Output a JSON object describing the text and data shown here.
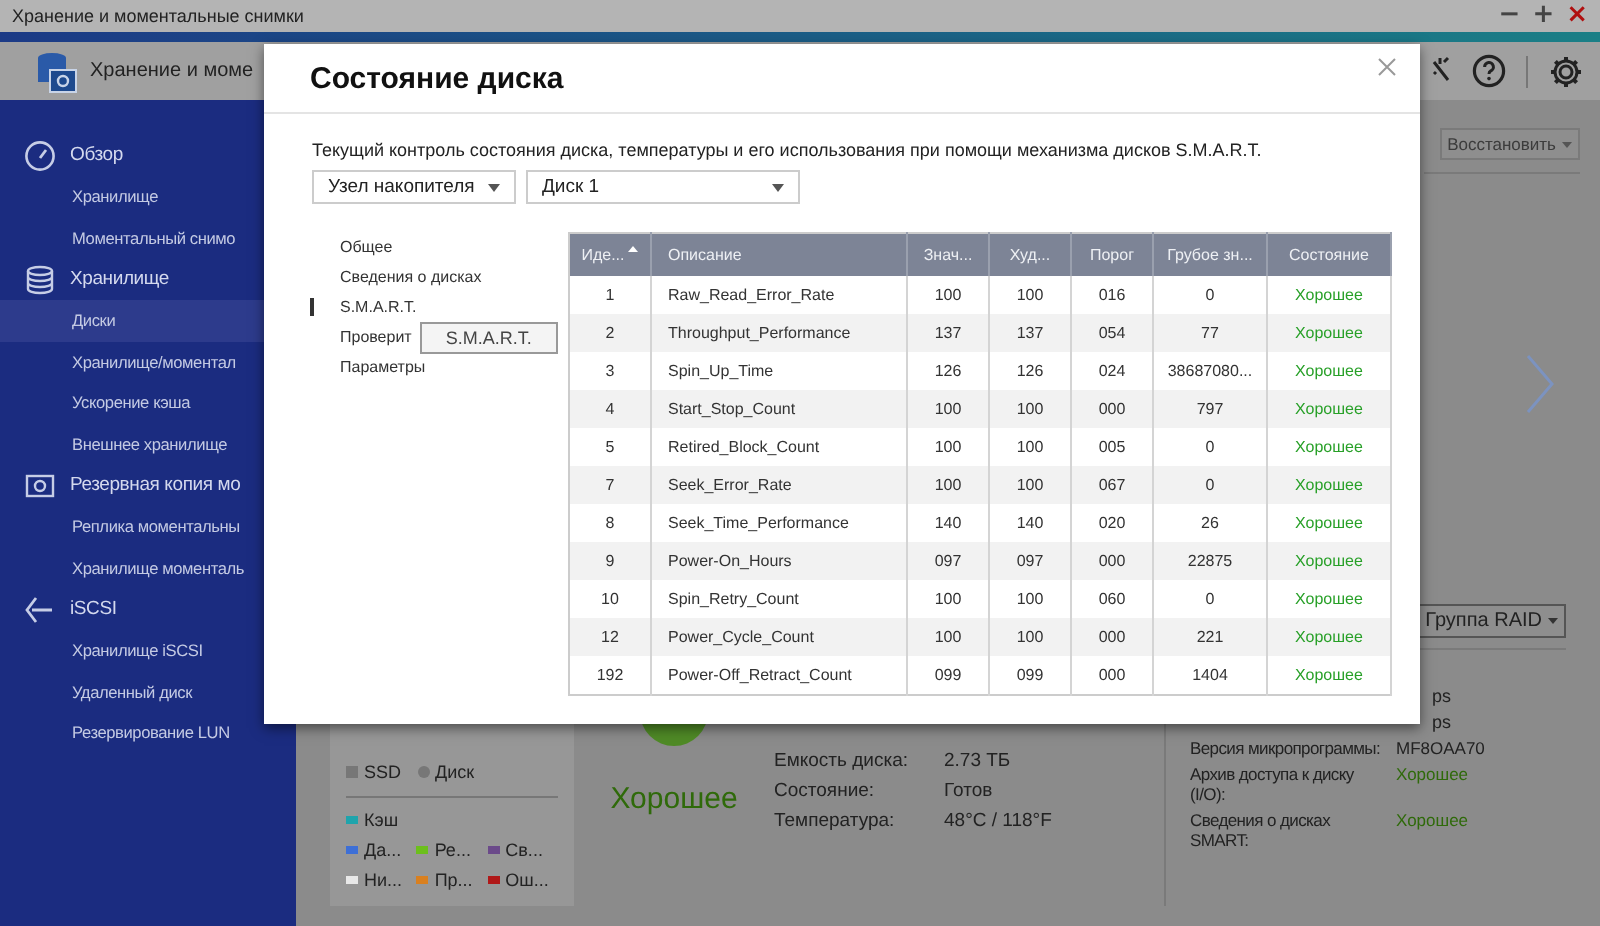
{
  "title_bar": {
    "title": "Хранение и моментальные снимки",
    "controls": [
      "−",
      "+",
      "×"
    ]
  },
  "header": {
    "title": "Хранение и моме"
  },
  "sidebar": {
    "sections": [
      {
        "label": "Обзор",
        "items": [
          {
            "label": "Хранилище",
            "selected": false
          },
          {
            "label": "Моментальный снимо",
            "selected": false
          }
        ]
      },
      {
        "label": "Хранилище",
        "items": [
          {
            "label": "Диски",
            "selected": true
          },
          {
            "label": "Хранилище/моментал",
            "selected": false
          },
          {
            "label": "Ускорение кэша",
            "selected": false
          },
          {
            "label": "Внешнее хранилище",
            "selected": false
          }
        ]
      },
      {
        "label": "Резервная копия мо",
        "items": [
          {
            "label": "Реплика моментальны",
            "selected": false
          },
          {
            "label": "Хранилище моменталь",
            "selected": false
          }
        ]
      },
      {
        "label": "iSCSI",
        "items": [
          {
            "label": "Хранилище iSCSI",
            "selected": false
          },
          {
            "label": "Удаленный диск",
            "selected": false
          },
          {
            "label": "Резервирование LUN",
            "selected": false
          }
        ]
      }
    ]
  },
  "main": {
    "restore_button": "Восстановить",
    "raid_button": "Группа RAID",
    "legend": {
      "types": [
        {
          "label": "SSD",
          "kind": "square"
        },
        {
          "label": "Диск",
          "kind": "circle"
        }
      ],
      "items": [
        {
          "label": "Кэш",
          "color": "#1fa4ac"
        },
        {
          "label": "Да...",
          "color": "#3d6fd6"
        },
        {
          "label": "Ре...",
          "color": "#6cbf1c"
        },
        {
          "label": "Св...",
          "color": "#6b4a8a"
        },
        {
          "label": "Ни...",
          "color": "#e8e8e8"
        },
        {
          "label": "Пр...",
          "color": "#d98020"
        },
        {
          "label": "Ош...",
          "color": "#b01818"
        }
      ]
    },
    "status": "Хорошее",
    "disk_info": [
      {
        "label": "Емкость диска:",
        "value": "2.73 ТБ"
      },
      {
        "label": "Состояние:",
        "value": "Готов"
      },
      {
        "label": "Температура:",
        "value": "48°C / 118°F"
      }
    ],
    "details": [
      {
        "kind": "partial",
        "value": "ps"
      },
      {
        "kind": "partial",
        "value": "ps"
      },
      {
        "kind": "field",
        "label": "Версия микропрограммы:",
        "value": "MF8OAA70",
        "good": false
      },
      {
        "kind": "field",
        "label": "Архив доступа к диску (I/O):",
        "value": "Хорошее",
        "good": true
      },
      {
        "kind": "field",
        "label": "Сведения о дисках SMART:",
        "value": "Хорошее",
        "good": true
      }
    ]
  },
  "modal": {
    "title": "Состояние диска",
    "description": "Текущий контроль состояния диска, температуры и его использования при помощи механизма дисков S.M.A.R.T.",
    "node_select": "Узел накопителя",
    "disk_select": "Диск 1",
    "nav": [
      {
        "label": "Общее",
        "selected": false
      },
      {
        "label": "Сведения о дисках",
        "selected": false
      },
      {
        "label": "S.M.A.R.T.",
        "selected": true
      },
      {
        "label": "Проверит",
        "selected": false
      },
      {
        "label": "Параметры",
        "selected": false
      }
    ],
    "smart_button": "S.M.A.R.T.",
    "table": {
      "columns": [
        "Иде...",
        "Описание",
        "Знач...",
        "Худ...",
        "Порог",
        "Грубое зн...",
        "Состояние"
      ],
      "rows": [
        [
          "1",
          "Raw_Read_Error_Rate",
          "100",
          "100",
          "016",
          "0",
          "Хорошее"
        ],
        [
          "2",
          "Throughput_Performance",
          "137",
          "137",
          "054",
          "77",
          "Хорошее"
        ],
        [
          "3",
          "Spin_Up_Time",
          "126",
          "126",
          "024",
          "38687080...",
          "Хорошее"
        ],
        [
          "4",
          "Start_Stop_Count",
          "100",
          "100",
          "000",
          "797",
          "Хорошее"
        ],
        [
          "5",
          "Retired_Block_Count",
          "100",
          "100",
          "005",
          "0",
          "Хорошее"
        ],
        [
          "7",
          "Seek_Error_Rate",
          "100",
          "100",
          "067",
          "0",
          "Хорошее"
        ],
        [
          "8",
          "Seek_Time_Performance",
          "140",
          "140",
          "020",
          "26",
          "Хорошее"
        ],
        [
          "9",
          "Power-On_Hours",
          "097",
          "097",
          "000",
          "22875",
          "Хорошее"
        ],
        [
          "10",
          "Spin_Retry_Count",
          "100",
          "100",
          "060",
          "0",
          "Хорошее"
        ],
        [
          "12",
          "Power_Cycle_Count",
          "100",
          "100",
          "000",
          "221",
          "Хорошее"
        ],
        [
          "192",
          "Power-Off_Retract_Count",
          "099",
          "099",
          "000",
          "1404",
          "Хорошее"
        ]
      ]
    }
  }
}
